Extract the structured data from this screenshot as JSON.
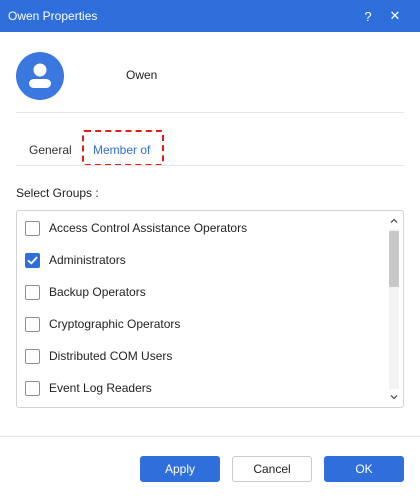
{
  "window": {
    "title": "Owen Properties",
    "help_glyph": "?",
    "close_glyph": "✕"
  },
  "user": {
    "name": "Owen",
    "avatar_icon": "user-avatar-icon",
    "avatar_color": "#3a78e0"
  },
  "tabs": [
    {
      "label": "General",
      "selected": false
    },
    {
      "label": "Member of",
      "selected": true
    }
  ],
  "groups": {
    "label": "Select Groups :",
    "items": [
      {
        "label": "Access Control Assistance Operators",
        "checked": false
      },
      {
        "label": "Administrators",
        "checked": true
      },
      {
        "label": "Backup Operators",
        "checked": false
      },
      {
        "label": "Cryptographic Operators",
        "checked": false
      },
      {
        "label": "Distributed COM Users",
        "checked": false
      },
      {
        "label": "Event Log Readers",
        "checked": false
      }
    ]
  },
  "buttons": {
    "apply": "Apply",
    "cancel": "Cancel",
    "ok": "OK"
  },
  "colors": {
    "accent": "#2f6fdb",
    "highlight_border": "#e01b1b"
  }
}
